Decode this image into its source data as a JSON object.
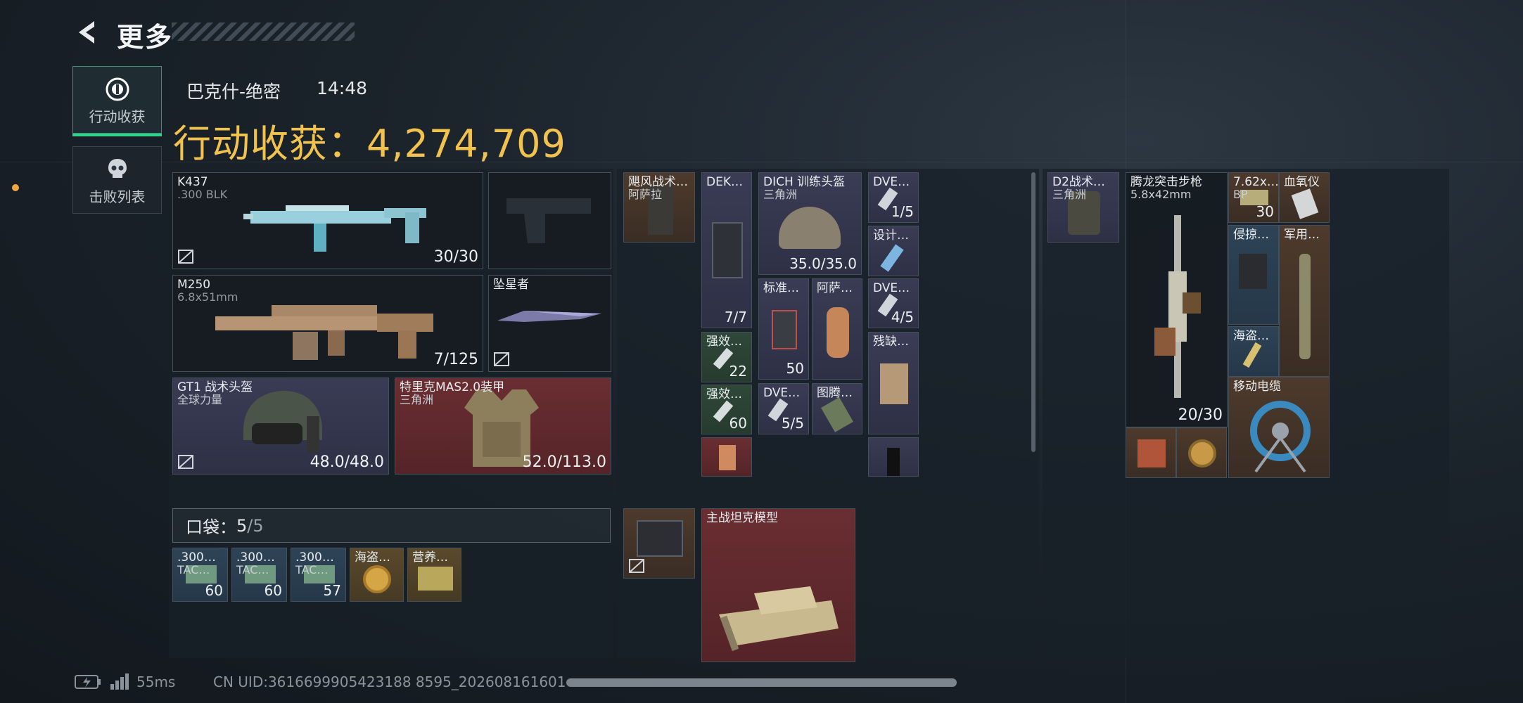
{
  "header": {
    "title": "更多",
    "back_label": "back"
  },
  "side_tabs": [
    {
      "label": "行动收获",
      "icon": "target-icon",
      "active": true
    },
    {
      "label": "击败列表",
      "icon": "skull-icon",
      "active": false
    }
  ],
  "match": {
    "map": "巴克什-绝密",
    "time": "14:48",
    "haul_label": "行动收获：",
    "haul_value": "4,274,709"
  },
  "loadout": {
    "primary": {
      "name": "K437",
      "ammo": ".300 BLK",
      "count": "30/30"
    },
    "pistol": {
      "name": ""
    },
    "secondary": {
      "name": "M250",
      "ammo": "6.8x51mm",
      "count": "7/125"
    },
    "melee": {
      "name": "坠星者"
    },
    "helmet": {
      "name": "GT1 战术头盔",
      "maker": "全球力量",
      "durability": "48.0/48.0"
    },
    "armor": {
      "name": "特里克MAS2.0装甲",
      "maker": "三角洲",
      "durability": "52.0/113.0"
    }
  },
  "pocket": {
    "label": "口袋：",
    "used": "5",
    "total": "/5",
    "items": [
      {
        "name": ".300…",
        "sub": "TAC…",
        "count": "60"
      },
      {
        "name": ".300…",
        "sub": "TAC…",
        "count": "60"
      },
      {
        "name": ".300…",
        "sub": "TAC…",
        "count": "57"
      },
      {
        "name": "海盗…",
        "sub": "",
        "count": ""
      },
      {
        "name": "营养…",
        "sub": "",
        "count": ""
      }
    ]
  },
  "rig": {
    "chest": {
      "name": "飓风战术…",
      "sub": "阿萨拉"
    },
    "items": {
      "dek": {
        "name": "DEK…",
        "count": "7/7"
      },
      "dich_helmet": {
        "name": "DICH 训练头盔",
        "sub": "三角洲",
        "durability": "35.0/35.0"
      },
      "dve1": {
        "name": "DVE…",
        "count": "1/5"
      },
      "design": {
        "name": "设计…"
      },
      "dve2": {
        "name": "DVE…",
        "count": "4/5"
      },
      "standard": {
        "name": "标准…",
        "count": "50"
      },
      "asala": {
        "name": "阿萨…"
      },
      "broken": {
        "name": "残缺…"
      },
      "boost1": {
        "name": "强效…",
        "count": "22"
      },
      "boost2": {
        "name": "强效…",
        "count": "60"
      },
      "dve3": {
        "name": "DVE…",
        "count": "5/5"
      },
      "tu": {
        "name": "图腾…"
      }
    }
  },
  "safe_box": {
    "name": "主战坦克模型"
  },
  "backpack": {
    "bag": {
      "name": "D2战术…",
      "sub": "三角洲"
    },
    "rifle": {
      "name": "腾龙突击步枪",
      "ammo": "5.8x42mm",
      "count": "20/30"
    },
    "ammo": {
      "name": "7.62x…",
      "sub": "BP",
      "count": "30"
    },
    "oximeter": {
      "name": "血氧仪"
    },
    "invader": {
      "name": "侵掠…"
    },
    "military": {
      "name": "军用…"
    },
    "pirate": {
      "name": "海盗…"
    },
    "cable": {
      "name": "移动电缆"
    }
  },
  "footer": {
    "ping": "55ms",
    "uid": "CN UID:3616699905423188 8595_202608161601"
  }
}
